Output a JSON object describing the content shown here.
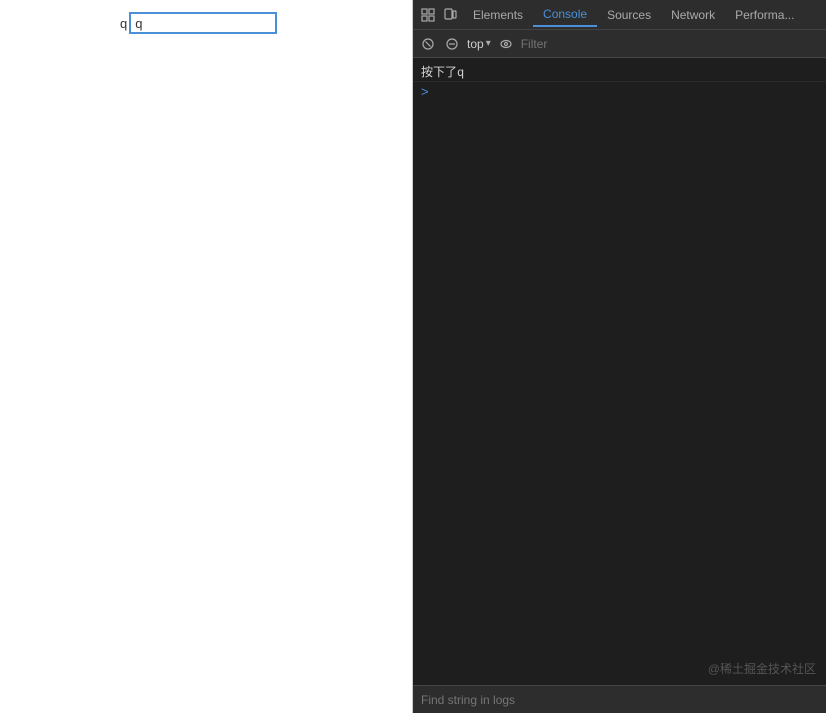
{
  "left_panel": {
    "input_label": "q",
    "input_value": "q",
    "input_placeholder": ""
  },
  "devtools": {
    "tabs": [
      {
        "label": "Elements",
        "active": false
      },
      {
        "label": "Console",
        "active": true
      },
      {
        "label": "Sources",
        "active": false
      },
      {
        "label": "Network",
        "active": false
      },
      {
        "label": "Performa...",
        "active": false
      }
    ],
    "console_toolbar": {
      "top_label": "top",
      "filter_placeholder": "Filter"
    },
    "console_output": {
      "message": "按下了q",
      "prompt_symbol": ">"
    },
    "find_bar": {
      "placeholder": "Find string in logs"
    },
    "watermark": "@稀土掘金技术社区"
  }
}
